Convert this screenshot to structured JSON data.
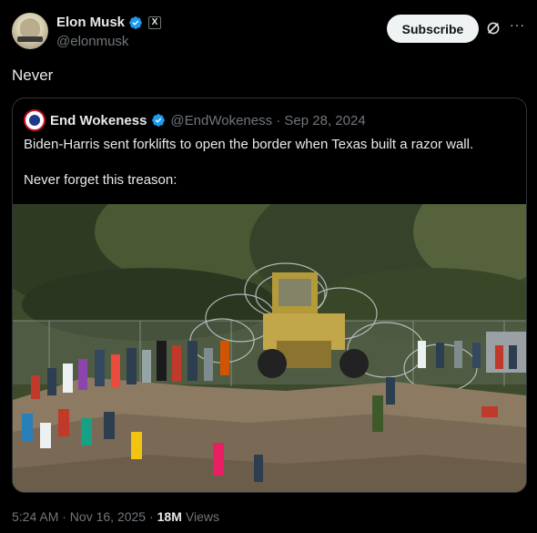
{
  "author": {
    "name": "Elon Musk",
    "handle": "@elonmusk",
    "affiliate_badge": "X"
  },
  "actions": {
    "subscribe_label": "Subscribe",
    "more_label": "···"
  },
  "post": {
    "text": "Never"
  },
  "quoted": {
    "name": "End Wokeness",
    "meta": "@EndWokeness · Sep 28, 2024",
    "text_line1": "Biden-Harris sent forklifts to open the border when Texas built a razor wall.",
    "text_line2": "Never forget this treason:",
    "media_icon": "photo-razor-wire-border"
  },
  "footer": {
    "timestamp": "5:24 AM · Nov 16, 2025 ·",
    "views_count": "18M",
    "views_label": "Views"
  },
  "colors": {
    "background": "#000000",
    "text": "#e7e9ea",
    "secondary": "#71767b",
    "verified": "#1d9bf0",
    "border": "#2f3336"
  }
}
